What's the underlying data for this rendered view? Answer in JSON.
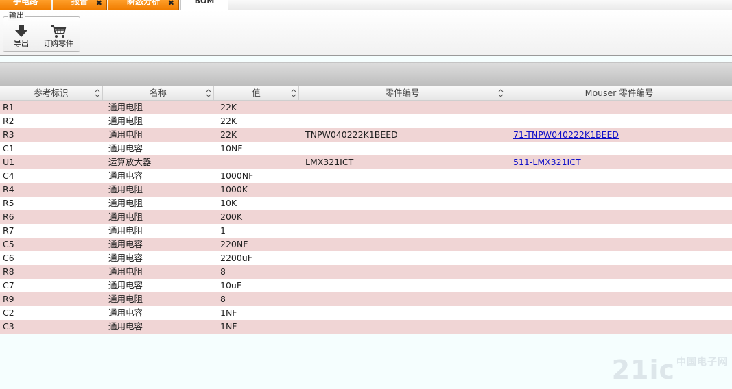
{
  "tabs": [
    {
      "label": "手电路",
      "active": false,
      "closable": false
    },
    {
      "label": "报告",
      "active": false,
      "closable": true
    },
    {
      "label": "瞬态分析",
      "active": false,
      "closable": true
    },
    {
      "label": "BOM",
      "active": true,
      "closable": false
    }
  ],
  "toolbar": {
    "group_title": "输出",
    "export_label": "导出",
    "order_label": "订购零件"
  },
  "table": {
    "columns": [
      "参考标识",
      "名称",
      "值",
      "零件编号",
      "Mouser 零件编号"
    ],
    "rows": [
      {
        "ref": "R1",
        "name": "通用电阻",
        "value": "22K",
        "part": "",
        "mouser": ""
      },
      {
        "ref": "R2",
        "name": "通用电阻",
        "value": "22K",
        "part": "",
        "mouser": ""
      },
      {
        "ref": "R3",
        "name": "通用电阻",
        "value": "22K",
        "part": "TNPW040222K1BEED",
        "mouser": "71-TNPW040222K1BEED"
      },
      {
        "ref": "C1",
        "name": "通用电容",
        "value": "10NF",
        "part": "",
        "mouser": ""
      },
      {
        "ref": "U1",
        "name": "运算放大器",
        "value": "",
        "part": "LMX321ICT",
        "mouser": "511-LMX321ICT"
      },
      {
        "ref": "C4",
        "name": "通用电容",
        "value": "1000NF",
        "part": "",
        "mouser": ""
      },
      {
        "ref": "R4",
        "name": "通用电阻",
        "value": "1000K",
        "part": "",
        "mouser": ""
      },
      {
        "ref": "R5",
        "name": "通用电阻",
        "value": "10K",
        "part": "",
        "mouser": ""
      },
      {
        "ref": "R6",
        "name": "通用电阻",
        "value": "200K",
        "part": "",
        "mouser": ""
      },
      {
        "ref": "R7",
        "name": "通用电阻",
        "value": "1",
        "part": "",
        "mouser": ""
      },
      {
        "ref": "C5",
        "name": "通用电容",
        "value": "220NF",
        "part": "",
        "mouser": ""
      },
      {
        "ref": "C6",
        "name": "通用电容",
        "value": "2200uF",
        "part": "",
        "mouser": ""
      },
      {
        "ref": "R8",
        "name": "通用电阻",
        "value": "8",
        "part": "",
        "mouser": ""
      },
      {
        "ref": "C7",
        "name": "通用电容",
        "value": "10uF",
        "part": "",
        "mouser": ""
      },
      {
        "ref": "R9",
        "name": "通用电阻",
        "value": "8",
        "part": "",
        "mouser": ""
      },
      {
        "ref": "C2",
        "name": "通用电容",
        "value": "1NF",
        "part": "",
        "mouser": ""
      },
      {
        "ref": "C3",
        "name": "通用电容",
        "value": "1NF",
        "part": "",
        "mouser": ""
      }
    ]
  },
  "colors": {
    "tab_orange": "#f58a10",
    "row_stripe": "#f0d5d5",
    "link": "#1010c8",
    "background": "#f5fefe"
  },
  "watermark": {
    "main": "21ic",
    "sub": "中国电子网"
  }
}
